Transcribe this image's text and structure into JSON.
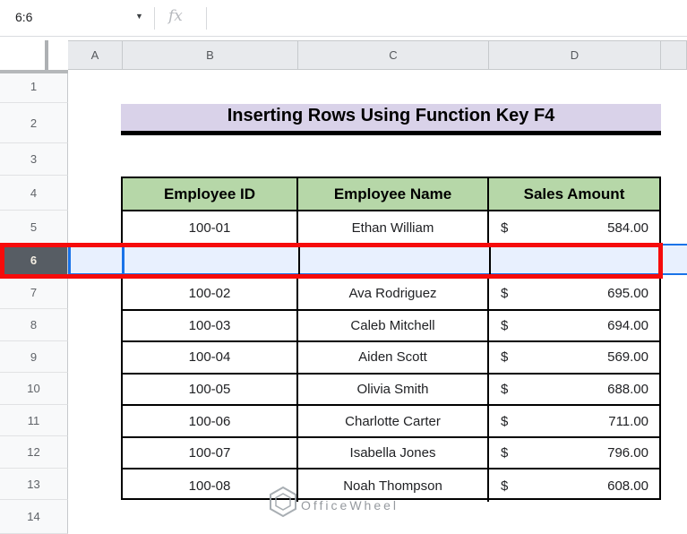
{
  "namebox": {
    "value": "6:6"
  },
  "formula_bar": {
    "fx_label": "fx",
    "value": ""
  },
  "column_headers": [
    "A",
    "B",
    "C",
    "D"
  ],
  "row_numbers": [
    "1",
    "2",
    "3",
    "4",
    "5",
    "6",
    "7",
    "8",
    "9",
    "10",
    "11",
    "12",
    "13",
    "14"
  ],
  "selected_row": "6",
  "title_banner": {
    "text": "Inserting Rows Using Function Key F4"
  },
  "table": {
    "headers": [
      "Employee ID",
      "Employee Name",
      "Sales Amount"
    ],
    "rows_above_insert": [
      {
        "id": "100-01",
        "name": "Ethan William",
        "currency": "$",
        "amount": "584.00"
      }
    ],
    "inserted_row_empty": true,
    "rows_below_insert": [
      {
        "id": "100-02",
        "name": "Ava Rodriguez",
        "currency": "$",
        "amount": "695.00"
      },
      {
        "id": "100-03",
        "name": "Caleb Mitchell",
        "currency": "$",
        "amount": "694.00"
      },
      {
        "id": "100-04",
        "name": "Aiden Scott",
        "currency": "$",
        "amount": "569.00"
      },
      {
        "id": "100-05",
        "name": "Olivia Smith",
        "currency": "$",
        "amount": "688.00"
      },
      {
        "id": "100-06",
        "name": "Charlotte Carter",
        "currency": "$",
        "amount": "711.00"
      },
      {
        "id": "100-07",
        "name": "Isabella Jones",
        "currency": "$",
        "amount": "796.00"
      },
      {
        "id": "100-08",
        "name": "Noah Thompson",
        "currency": "$",
        "amount": "608.00"
      }
    ]
  },
  "watermark": {
    "text": "OfficeWheel"
  },
  "colors": {
    "annotation_red": "#f60b0b",
    "selection_blue": "#1a73e8",
    "selection_fill": "#e8f0fe",
    "header_green": "#b6d7a8",
    "title_purple": "#d9d2e9",
    "selected_rowheader_bg": "#575d64"
  }
}
